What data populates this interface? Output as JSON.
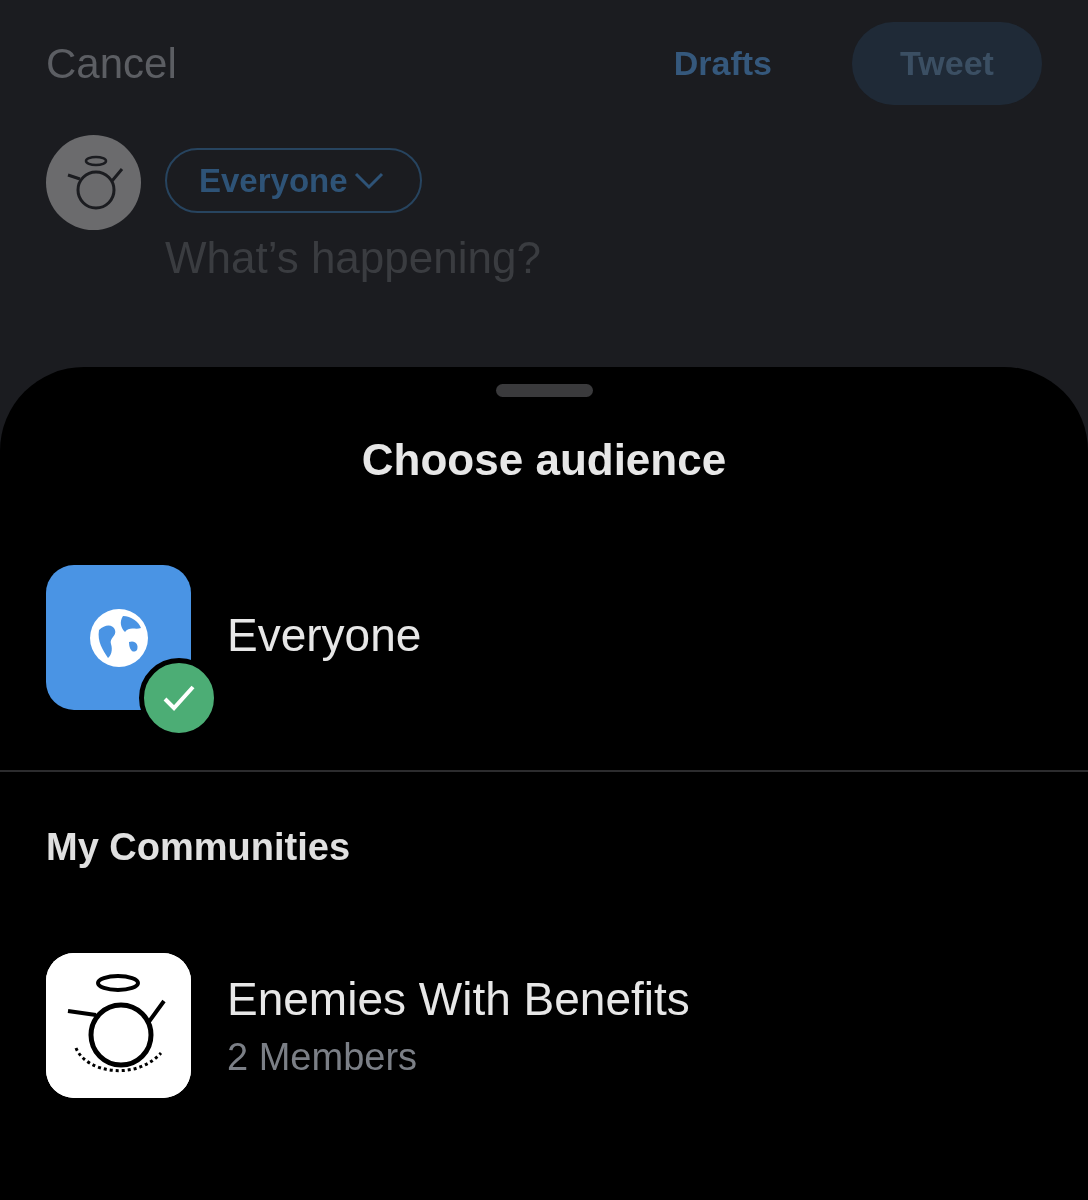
{
  "compose": {
    "cancel": "Cancel",
    "drafts": "Drafts",
    "tweet": "Tweet",
    "audience_pill": "Everyone",
    "placeholder": "What’s happening?"
  },
  "sheet": {
    "title": "Choose audience",
    "options": [
      {
        "kind": "globe",
        "label": "Everyone",
        "selected": true
      }
    ],
    "section_title": "My Communities",
    "communities": [
      {
        "kind": "picture",
        "name": "Enemies With Benefits",
        "members": "2 Members",
        "selected": false
      }
    ]
  }
}
